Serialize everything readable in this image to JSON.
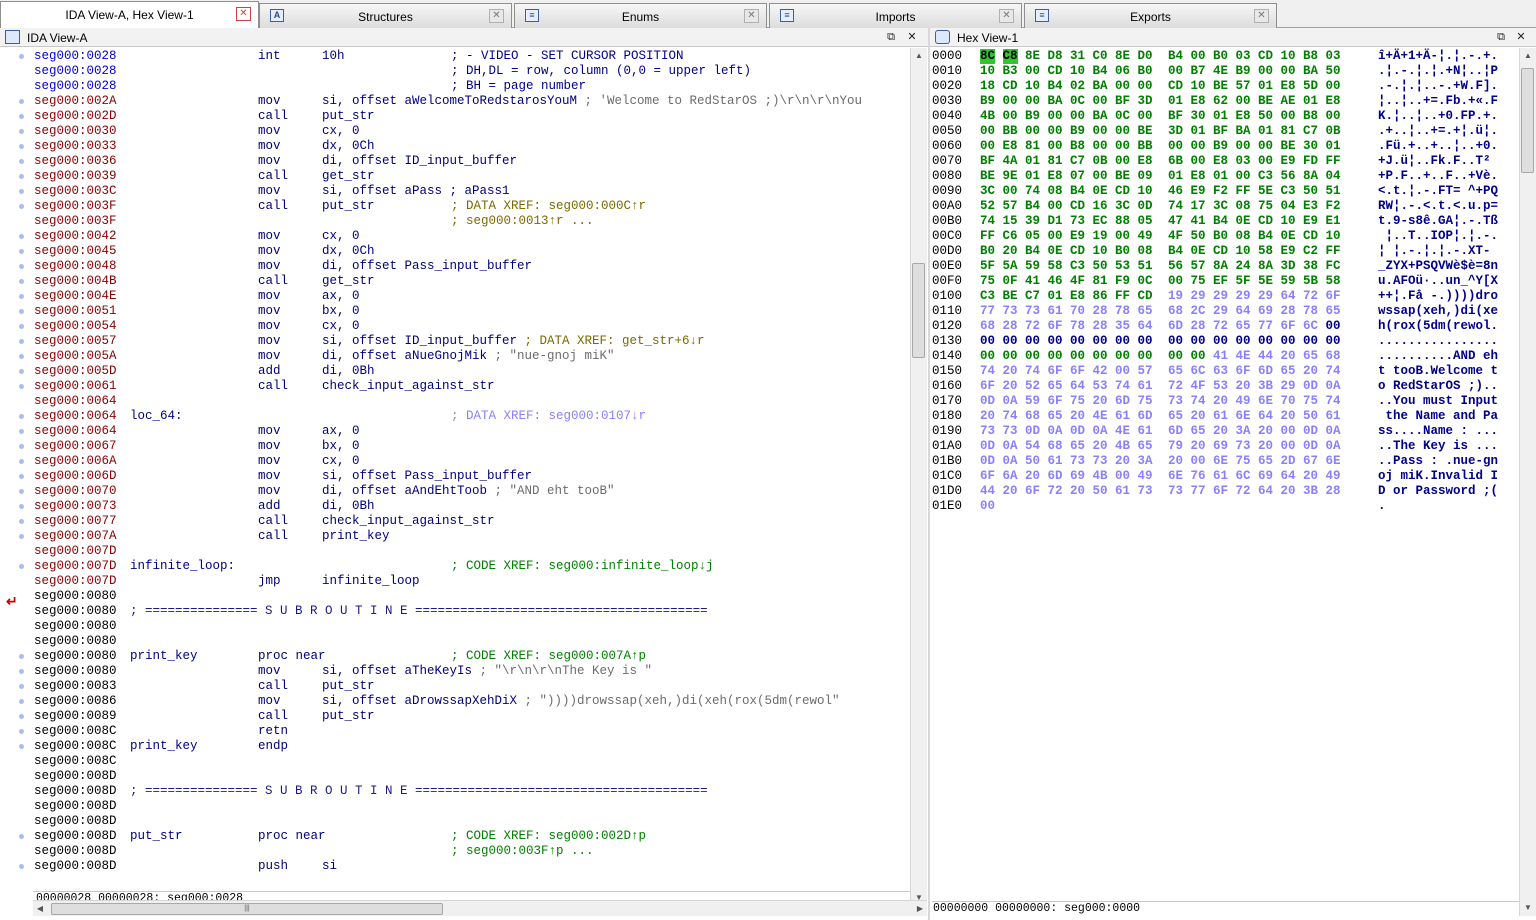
{
  "tabs": [
    {
      "label": "IDA View-A, Hex View-1",
      "icon": "ida-view-icon"
    },
    {
      "label": "Structures",
      "icon": "structures-icon"
    },
    {
      "label": "Enums",
      "icon": "enums-icon"
    },
    {
      "label": "Imports",
      "icon": "imports-icon"
    },
    {
      "label": "Exports",
      "icon": "exports-icon"
    }
  ],
  "ida_view": {
    "title": "IDA View-A",
    "status": "00000028 00000028: seg000:0028",
    "lines": [
      {
        "addr": "seg000:0028",
        "ac": "aB",
        "mnem": "int",
        "op": "10h",
        "cm": "; - VIDEO - SET CURSOR POSITION",
        "cc": "cb"
      },
      {
        "addr": "seg000:0028",
        "ac": "aB",
        "cm": "; DH,DL = row, column (0,0 = upper left)",
        "cc": "cb"
      },
      {
        "addr": "seg000:0028",
        "ac": "aB",
        "cm": "; BH = page number",
        "cc": "cb"
      },
      {
        "addr": "seg000:002A",
        "ac": "aR",
        "mnem": "mov",
        "op": "si, offset aWelcomeToRedstarosYouM",
        "cm": "; 'Welcome to RedStarOS ;)\\r\\n\\r\\nYou",
        "cc": "cm",
        "cmx": true
      },
      {
        "addr": "seg000:002D",
        "ac": "aR",
        "mnem": "call",
        "op": "put_str"
      },
      {
        "addr": "seg000:0030",
        "ac": "aR",
        "mnem": "mov",
        "op": "cx, 0"
      },
      {
        "addr": "seg000:0033",
        "ac": "aR",
        "mnem": "mov",
        "op": "dx, 0Ch"
      },
      {
        "addr": "seg000:0036",
        "ac": "aR",
        "mnem": "mov",
        "op": "di, offset ID_input_buffer"
      },
      {
        "addr": "seg000:0039",
        "ac": "aR",
        "mnem": "call",
        "op": "get_str"
      },
      {
        "addr": "seg000:003C",
        "ac": "aR",
        "mnem": "mov",
        "op": "si, offset aPass ; aPass1"
      },
      {
        "addr": "seg000:003F",
        "ac": "aR",
        "mnem": "call",
        "op": "put_str",
        "cm": "; DATA XREF: seg000:000C↑r",
        "cc": "xo"
      },
      {
        "addr": "seg000:003F",
        "ac": "aR",
        "cm": "; seg000:0013↑r ...",
        "cc": "xo"
      },
      {
        "addr": "seg000:0042",
        "ac": "aR",
        "mnem": "mov",
        "op": "cx, 0"
      },
      {
        "addr": "seg000:0045",
        "ac": "aR",
        "mnem": "mov",
        "op": "dx, 0Ch"
      },
      {
        "addr": "seg000:0048",
        "ac": "aR",
        "mnem": "mov",
        "op": "di, offset Pass_input_buffer"
      },
      {
        "addr": "seg000:004B",
        "ac": "aR",
        "mnem": "call",
        "op": "get_str"
      },
      {
        "addr": "seg000:004E",
        "ac": "aR",
        "mnem": "mov",
        "op": "ax, 0"
      },
      {
        "addr": "seg000:0051",
        "ac": "aR",
        "mnem": "mov",
        "op": "bx, 0"
      },
      {
        "addr": "seg000:0054",
        "ac": "aR",
        "mnem": "mov",
        "op": "cx, 0"
      },
      {
        "addr": "seg000:0057",
        "ac": "aR",
        "mnem": "mov",
        "op": "si, offset ID_input_buffer",
        "cm": "; DATA XREF: get_str+6↓r",
        "cc": "xo",
        "cmx": true
      },
      {
        "addr": "seg000:005A",
        "ac": "aR",
        "mnem": "mov",
        "op": "di, offset aNueGnojMik",
        "cm": "; \"nue-gnoj miK\"",
        "cc": "cm",
        "cmx": true
      },
      {
        "addr": "seg000:005D",
        "ac": "aR",
        "mnem": "add",
        "op": "di, 0Bh"
      },
      {
        "addr": "seg000:0061",
        "ac": "aR",
        "mnem": "call",
        "op": "check_input_against_str"
      },
      {
        "addr": "seg000:0064",
        "ac": "aR"
      },
      {
        "addr": "seg000:0064",
        "ac": "aR",
        "lbl": "loc_64:",
        "cm": "; DATA XREF: seg000:0107↓r",
        "cc": "xb"
      },
      {
        "addr": "seg000:0064",
        "ac": "aR",
        "mnem": "mov",
        "op": "ax, 0"
      },
      {
        "addr": "seg000:0067",
        "ac": "aR",
        "mnem": "mov",
        "op": "bx, 0"
      },
      {
        "addr": "seg000:006A",
        "ac": "aR",
        "mnem": "mov",
        "op": "cx, 0"
      },
      {
        "addr": "seg000:006D",
        "ac": "aR",
        "mnem": "mov",
        "op": "si, offset Pass_input_buffer"
      },
      {
        "addr": "seg000:0070",
        "ac": "aR",
        "mnem": "mov",
        "op": "di, offset aAndEhtToob",
        "cm": "; \"AND eht tooB\"",
        "cc": "cm",
        "cmx": true
      },
      {
        "addr": "seg000:0073",
        "ac": "aR",
        "mnem": "add",
        "op": "di, 0Bh"
      },
      {
        "addr": "seg000:0077",
        "ac": "aR",
        "mnem": "call",
        "op": "check_input_against_str"
      },
      {
        "addr": "seg000:007A",
        "ac": "aR",
        "mnem": "call",
        "op": "print_key"
      },
      {
        "addr": "seg000:007D",
        "ac": "aR"
      },
      {
        "addr": "seg000:007D",
        "ac": "aR",
        "lbl": "infinite_loop:",
        "cm": "; CODE XREF: seg000:infinite_loop↓j",
        "cc": "cg"
      },
      {
        "addr": "seg000:007D",
        "ac": "aR",
        "mnem": "jmp",
        "op": "infinite_loop"
      },
      {
        "addr": "seg000:0080",
        "ac": "aK"
      },
      {
        "addr": "seg000:0080",
        "ac": "aK",
        "sep": "; =============== S U B R O U T I N E ======================================="
      },
      {
        "addr": "seg000:0080",
        "ac": "aK"
      },
      {
        "addr": "seg000:0080",
        "ac": "aK"
      },
      {
        "addr": "seg000:0080",
        "ac": "aK",
        "lbl": "print_key",
        "mnem2": "proc near",
        "cm": "; CODE XREF: seg000:007A↑p",
        "cc": "cg"
      },
      {
        "addr": "seg000:0080",
        "ac": "aK",
        "mnem": "mov",
        "op": "si, offset aTheKeyIs",
        "cm": "; \"\\r\\n\\r\\nThe Key is \"",
        "cc": "cm",
        "cmx": true
      },
      {
        "addr": "seg000:0083",
        "ac": "aK",
        "mnem": "call",
        "op": "put_str"
      },
      {
        "addr": "seg000:0086",
        "ac": "aK",
        "mnem": "mov",
        "op": "si, offset aDrowssapXehDiX",
        "cm": "; \"))))drowssap(xeh,)di(xeh(rox(5dm(rewol\"",
        "cc": "cm",
        "cmx": true
      },
      {
        "addr": "seg000:0089",
        "ac": "aK",
        "mnem": "call",
        "op": "put_str"
      },
      {
        "addr": "seg000:008C",
        "ac": "aK",
        "mnem": "retn"
      },
      {
        "addr": "seg000:008C",
        "ac": "aK",
        "lbl": "print_key",
        "mnem2": "endp"
      },
      {
        "addr": "seg000:008C",
        "ac": "aK"
      },
      {
        "addr": "seg000:008D",
        "ac": "aK"
      },
      {
        "addr": "seg000:008D",
        "ac": "aK",
        "sep": "; =============== S U B R O U T I N E ======================================="
      },
      {
        "addr": "seg000:008D",
        "ac": "aK"
      },
      {
        "addr": "seg000:008D",
        "ac": "aK"
      },
      {
        "addr": "seg000:008D",
        "ac": "aK",
        "lbl": "put_str",
        "mnem2": "proc near",
        "cm": "; CODE XREF: seg000:002D↑p",
        "cc": "cg"
      },
      {
        "addr": "seg000:008D",
        "ac": "aK",
        "cm": "; seg000:003F↑p ...",
        "cc": "cg"
      },
      {
        "addr": "seg000:008D",
        "ac": "aK",
        "mnem": "push",
        "op": "si"
      }
    ]
  },
  "hex_view": {
    "title": "Hex View-1",
    "status": "00000000 00000000: seg000:0000",
    "rows": [
      {
        "a": "0000",
        "b": "8C C8 8E D8 31 C0 8E D0  B4 00 B0 03 CD 10 B8 03",
        "t": "î+Ä+1+Ä-¦.¦.-.+.",
        "c": "g",
        "sel": true
      },
      {
        "a": "0010",
        "b": "10 B3 00 CD 10 B4 06 B0  00 B7 4E B9 00 00 BA 50",
        "t": ".¦.-.¦.¦.+N¦..¦P",
        "c": "g"
      },
      {
        "a": "0020",
        "b": "18 CD 10 B4 02 BA 00 00  CD 10 BE 57 01 E8 5D 00",
        "t": ".-.¦.¦..-.+W.F].",
        "c": "g"
      },
      {
        "a": "0030",
        "b": "B9 00 00 BA 0C 00 BF 3D  01 E8 62 00 BE AE 01 E8",
        "t": "¦..¦..+=.Fb.+«.F",
        "c": "g"
      },
      {
        "a": "0040",
        "b": "4B 00 B9 00 00 BA 0C 00  BF 30 01 E8 50 00 B8 00",
        "t": "K.¦..¦..+0.FP.+.",
        "c": "g"
      },
      {
        "a": "0050",
        "b": "00 BB 00 00 B9 00 00 BE  3D 01 BF BA 01 81 C7 0B",
        "t": ".+..¦..+=.+¦.ü¦.",
        "c": "g"
      },
      {
        "a": "0060",
        "b": "00 E8 81 00 B8 00 00 BB  00 00 B9 00 00 BE 30 01",
        "t": ".Fü.+..+..¦..+0.",
        "c": "g"
      },
      {
        "a": "0070",
        "b": "BF 4A 01 81 C7 0B 00 E8  6B 00 E8 03 00 E9 FD FF",
        "t": "+J.ü¦..Fk.F..T² ",
        "c": "g"
      },
      {
        "a": "0080",
        "b": "BE 9E 01 E8 07 00 BE 09  01 E8 01 00 C3 56 8A 04",
        "t": "+P.F..+..F..+Vè.",
        "c": "g"
      },
      {
        "a": "0090",
        "b": "3C 00 74 08 B4 0E CD 10  46 E9 F2 FF 5E C3 50 51",
        "t": "<.t.¦.-.FT= ^+PQ",
        "c": "g"
      },
      {
        "a": "00A0",
        "b": "52 57 B4 00 CD 16 3C 0D  74 17 3C 08 75 04 E3 F2",
        "t": "RW¦.-.<.t.<.u.p=",
        "c": "g"
      },
      {
        "a": "00B0",
        "b": "74 15 39 D1 73 EC 88 05  47 41 B4 0E CD 10 E9 E1",
        "t": "t.9-s8ê.GA¦.-.Tß",
        "c": "g"
      },
      {
        "a": "00C0",
        "b": "FF C6 05 00 E9 19 00 49  4F 50 B0 08 B4 0E CD 10",
        "t": " ¦..T..IOP¦.¦.-.",
        "c": "g"
      },
      {
        "a": "00D0",
        "b": "B0 20 B4 0E CD 10 B0 08  B4 0E CD 10 58 E9 C2 FF",
        "t": "¦ ¦.-.¦.¦.-.XT- ",
        "c": "g"
      },
      {
        "a": "00E0",
        "b": "5F 5A 59 58 C3 50 53 51  56 57 8A 24 8A 3D 38 FC",
        "t": "_ZYX+PSQVWè$è=8n",
        "c": "g"
      },
      {
        "a": "00F0",
        "b": "75 0F 41 46 4F 81 F9 0C  00 75 EF 5F 5E 59 5B 58",
        "t": "u.AFOü·..un_^Y[X",
        "c": "g"
      },
      {
        "a": "0100",
        "b": "C3 BE C7 01 E8 86 FF CD  19 29 29 29 29 64 72 6F",
        "t": "++¦.Få -.))))dro",
        "c": "g",
        "split": 8
      },
      {
        "a": "0110",
        "b": "77 73 73 61 70 28 78 65  68 2C 29 64 69 28 78 65",
        "t": "wssap(xeh,)di(xe",
        "c": "l"
      },
      {
        "a": "0120",
        "b": "68 28 72 6F 78 28 35 64  6D 28 72 65 77 6F 6C 00",
        "t": "h(rox(5dm(rewol.",
        "c": "l",
        "tail": true
      },
      {
        "a": "0130",
        "b": "00 00 00 00 00 00 00 00  00 00 00 00 00 00 00 00",
        "t": "................",
        "c": "b"
      },
      {
        "a": "0140",
        "b": "00 00 00 00 00 00 00 00  00 00 41 4E 44 20 65 68",
        "t": "..........AND eh",
        "c": "b",
        "split": 10
      },
      {
        "a": "0150",
        "b": "74 20 74 6F 6F 42 00 57  65 6C 63 6F 6D 65 20 74",
        "t": "t tooB.Welcome t",
        "c": "l"
      },
      {
        "a": "0160",
        "b": "6F 20 52 65 64 53 74 61  72 4F 53 20 3B 29 0D 0A",
        "t": "o RedStarOS ;)..",
        "c": "l"
      },
      {
        "a": "0170",
        "b": "0D 0A 59 6F 75 20 6D 75  73 74 20 49 6E 70 75 74",
        "t": "..You must Input",
        "c": "l"
      },
      {
        "a": "0180",
        "b": "20 74 68 65 20 4E 61 6D  65 20 61 6E 64 20 50 61",
        "t": " the Name and Pa",
        "c": "l"
      },
      {
        "a": "0190",
        "b": "73 73 0D 0A 0D 0A 4E 61  6D 65 20 3A 20 00 0D 0A",
        "t": "ss....Name : ...",
        "c": "l"
      },
      {
        "a": "01A0",
        "b": "0D 0A 54 68 65 20 4B 65  79 20 69 73 20 00 0D 0A",
        "t": "..The Key is ...",
        "c": "l"
      },
      {
        "a": "01B0",
        "b": "0D 0A 50 61 73 73 20 3A  20 00 6E 75 65 2D 67 6E",
        "t": "..Pass : .nue-gn",
        "c": "l"
      },
      {
        "a": "01C0",
        "b": "6F 6A 20 6D 69 4B 00 49  6E 76 61 6C 69 64 20 49",
        "t": "oj miK.Invalid I",
        "c": "l"
      },
      {
        "a": "01D0",
        "b": "44 20 6F 72 20 50 61 73  73 77 6F 72 64 20 3B 28",
        "t": "D or Password ;(",
        "c": "l"
      },
      {
        "a": "01E0",
        "b": "00",
        "t": ".",
        "c": "l"
      }
    ]
  }
}
